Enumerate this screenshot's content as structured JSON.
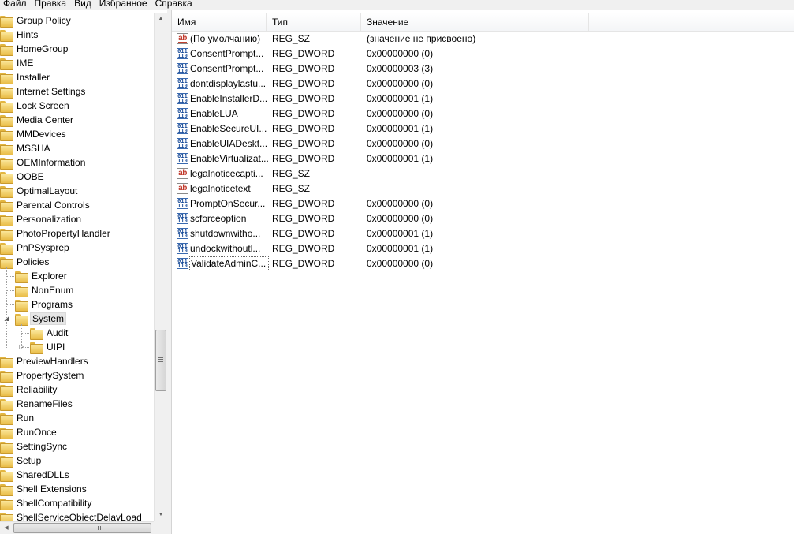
{
  "menu": [
    "Файл",
    "Правка",
    "Вид",
    "Избранное",
    "Справка"
  ],
  "tree": {
    "items": [
      {
        "label": "Group Policy",
        "level": 0
      },
      {
        "label": "Hints",
        "level": 0
      },
      {
        "label": "HomeGroup",
        "level": 0
      },
      {
        "label": "IME",
        "level": 0
      },
      {
        "label": "Installer",
        "level": 0
      },
      {
        "label": "Internet Settings",
        "level": 0
      },
      {
        "label": "Lock Screen",
        "level": 0
      },
      {
        "label": "Media Center",
        "level": 0
      },
      {
        "label": "MMDevices",
        "level": 0
      },
      {
        "label": "MSSHA",
        "level": 0
      },
      {
        "label": "OEMInformation",
        "level": 0
      },
      {
        "label": "OOBE",
        "level": 0
      },
      {
        "label": "OptimalLayout",
        "level": 0
      },
      {
        "label": "Parental Controls",
        "level": 0
      },
      {
        "label": "Personalization",
        "level": 0
      },
      {
        "label": "PhotoPropertyHandler",
        "level": 0
      },
      {
        "label": "PnPSysprep",
        "level": 0
      },
      {
        "label": "Policies",
        "level": 0
      },
      {
        "label": "Explorer",
        "level": 1
      },
      {
        "label": "NonEnum",
        "level": 1
      },
      {
        "label": "Programs",
        "level": 1
      },
      {
        "label": "System",
        "level": 1,
        "selected": true,
        "expanded": true
      },
      {
        "label": "Audit",
        "level": 2
      },
      {
        "label": "UIPI",
        "level": 2,
        "collapsed": true
      },
      {
        "label": "PreviewHandlers",
        "level": 0
      },
      {
        "label": "PropertySystem",
        "level": 0
      },
      {
        "label": "Reliability",
        "level": 0
      },
      {
        "label": "RenameFiles",
        "level": 0
      },
      {
        "label": "Run",
        "level": 0
      },
      {
        "label": "RunOnce",
        "level": 0
      },
      {
        "label": "SettingSync",
        "level": 0
      },
      {
        "label": "Setup",
        "level": 0
      },
      {
        "label": "SharedDLLs",
        "level": 0
      },
      {
        "label": "Shell Extensions",
        "level": 0
      },
      {
        "label": "ShellCompatibility",
        "level": 0
      },
      {
        "label": "ShellServiceObjectDelayLoad",
        "level": 0
      }
    ]
  },
  "columns": {
    "name": "Имя",
    "type": "Тип",
    "data": "Значение"
  },
  "values": [
    {
      "icon": "string-value-icon",
      "name": "(По умолчанию)",
      "type": "REG_SZ",
      "data": "(значение не присвоено)"
    },
    {
      "icon": "dword-value-icon",
      "name": "ConsentPrompt...",
      "type": "REG_DWORD",
      "data": "0x00000000 (0)"
    },
    {
      "icon": "dword-value-icon",
      "name": "ConsentPrompt...",
      "type": "REG_DWORD",
      "data": "0x00000003 (3)"
    },
    {
      "icon": "dword-value-icon",
      "name": "dontdisplaylastu...",
      "type": "REG_DWORD",
      "data": "0x00000000 (0)"
    },
    {
      "icon": "dword-value-icon",
      "name": "EnableInstallerD...",
      "type": "REG_DWORD",
      "data": "0x00000001 (1)"
    },
    {
      "icon": "dword-value-icon",
      "name": "EnableLUA",
      "type": "REG_DWORD",
      "data": "0x00000000 (0)"
    },
    {
      "icon": "dword-value-icon",
      "name": "EnableSecureUI...",
      "type": "REG_DWORD",
      "data": "0x00000001 (1)"
    },
    {
      "icon": "dword-value-icon",
      "name": "EnableUIADeskt...",
      "type": "REG_DWORD",
      "data": "0x00000000 (0)"
    },
    {
      "icon": "dword-value-icon",
      "name": "EnableVirtualizat...",
      "type": "REG_DWORD",
      "data": "0x00000001 (1)"
    },
    {
      "icon": "string-value-icon",
      "name": "legalnoticecapti...",
      "type": "REG_SZ",
      "data": ""
    },
    {
      "icon": "string-value-icon",
      "name": "legalnoticetext",
      "type": "REG_SZ",
      "data": ""
    },
    {
      "icon": "dword-value-icon",
      "name": "PromptOnSecur...",
      "type": "REG_DWORD",
      "data": "0x00000000 (0)"
    },
    {
      "icon": "dword-value-icon",
      "name": "scforceoption",
      "type": "REG_DWORD",
      "data": "0x00000000 (0)"
    },
    {
      "icon": "dword-value-icon",
      "name": "shutdownwitho...",
      "type": "REG_DWORD",
      "data": "0x00000001 (1)"
    },
    {
      "icon": "dword-value-icon",
      "name": "undockwithoutl...",
      "type": "REG_DWORD",
      "data": "0x00000001 (1)"
    },
    {
      "icon": "dword-value-icon",
      "name": "ValidateAdminC...",
      "type": "REG_DWORD",
      "data": "0x00000000 (0)",
      "focused": true
    }
  ],
  "icon_glyphs": {
    "string": "ab",
    "dword": "011"
  }
}
